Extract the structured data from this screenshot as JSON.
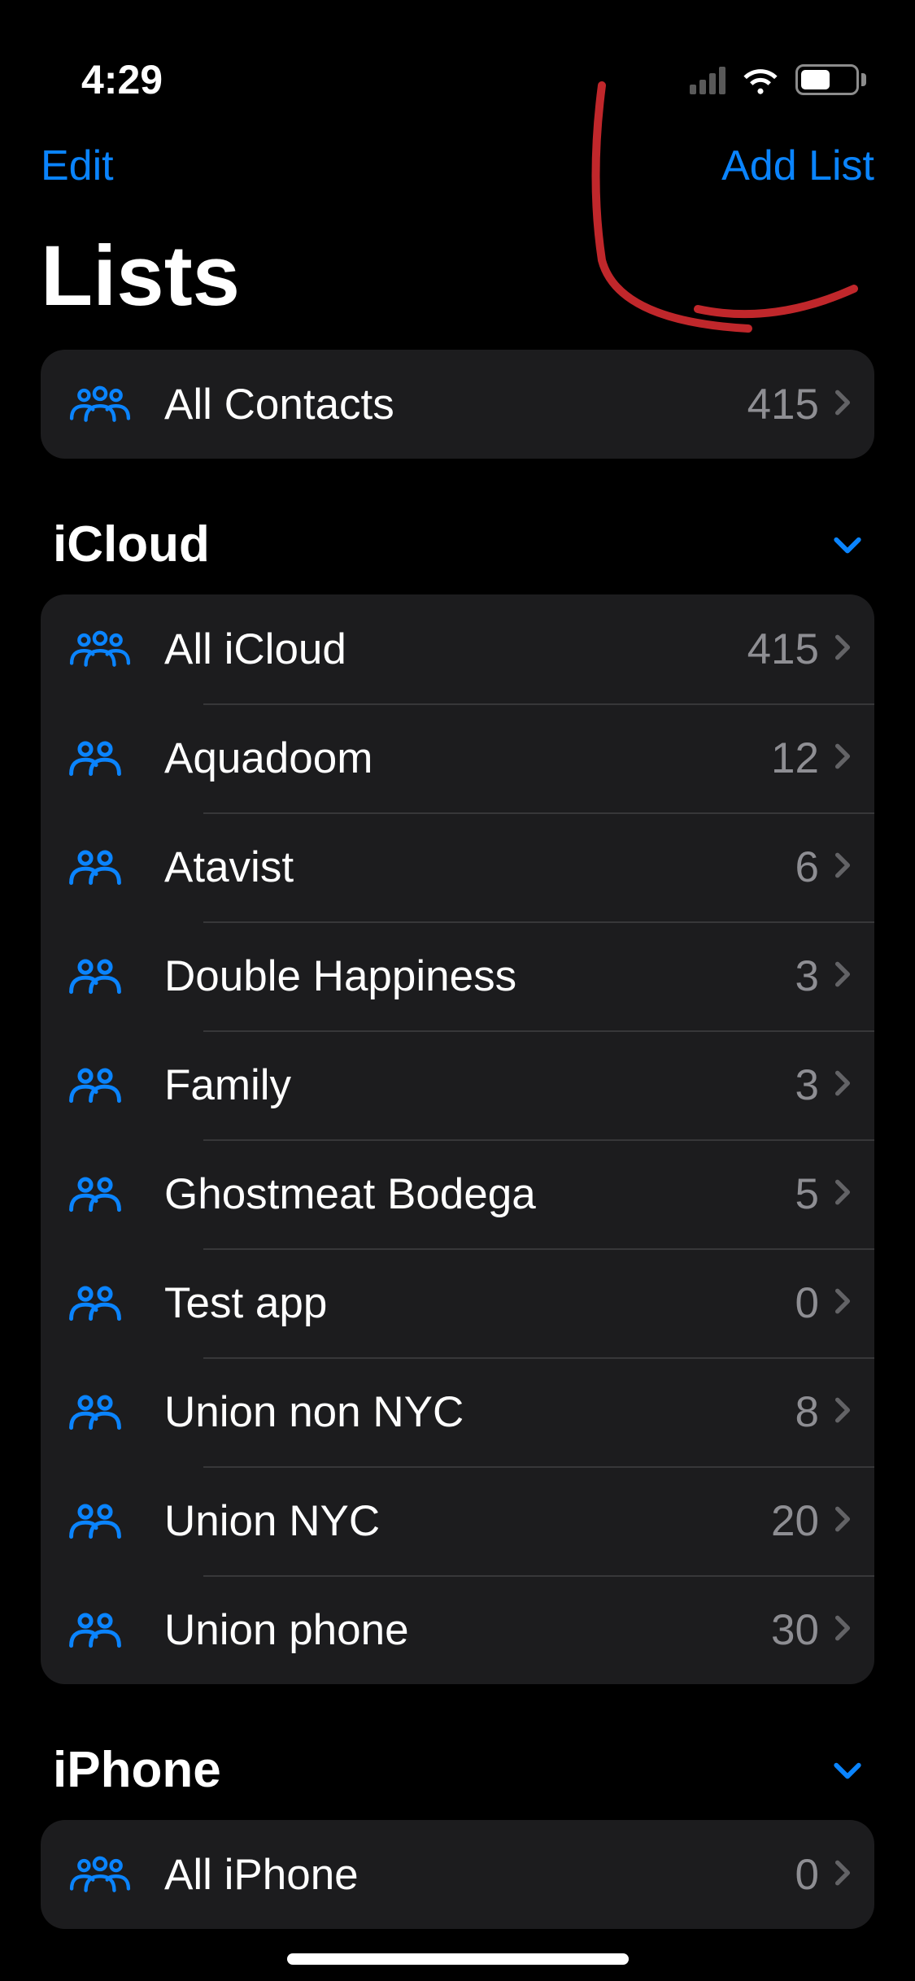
{
  "status": {
    "time": "4:29"
  },
  "nav": {
    "edit": "Edit",
    "add_list": "Add List"
  },
  "title": "Lists",
  "top_row": {
    "label": "All Contacts",
    "count": "415",
    "icon": "group3"
  },
  "sections": [
    {
      "title": "iCloud",
      "rows": [
        {
          "label": "All iCloud",
          "count": "415",
          "icon": "group3"
        },
        {
          "label": "Aquadoom",
          "count": "12",
          "icon": "group2"
        },
        {
          "label": "Atavist",
          "count": "6",
          "icon": "group2"
        },
        {
          "label": "Double Happiness",
          "count": "3",
          "icon": "group2"
        },
        {
          "label": "Family",
          "count": "3",
          "icon": "group2"
        },
        {
          "label": "Ghostmeat Bodega",
          "count": "5",
          "icon": "group2"
        },
        {
          "label": "Test app",
          "count": "0",
          "icon": "group2"
        },
        {
          "label": "Union non NYC",
          "count": "8",
          "icon": "group2"
        },
        {
          "label": "Union NYC",
          "count": "20",
          "icon": "group2"
        },
        {
          "label": "Union phone",
          "count": "30",
          "icon": "group2"
        }
      ]
    },
    {
      "title": "iPhone",
      "rows": [
        {
          "label": "All iPhone",
          "count": "0",
          "icon": "group3"
        }
      ]
    }
  ],
  "colors": {
    "accent": "#0a84ff",
    "card": "#1c1c1e",
    "secondary": "#8e8e93"
  }
}
